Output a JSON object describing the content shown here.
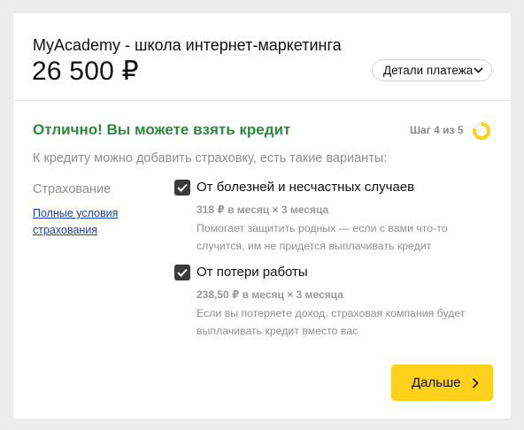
{
  "order": {
    "merchant": "MyAcademy - школа интернет-маркетинга",
    "amount": "26 500 ₽",
    "details_label": "Детали платежа"
  },
  "status": {
    "title": "Отлично! Вы можете взять кредит",
    "step": "Шаг 4 из 5",
    "step_progress": 0.8,
    "subtitle": "К кредиту можно добавить страховку, есть такие варианты:"
  },
  "insurance": {
    "label": "Страхование",
    "terms_link_line1": "Полные условия",
    "terms_link_line2": "страхования",
    "options": [
      {
        "title": "От болезней и несчастных случаев",
        "price": "318 ₽ в месяц × 3 месяца",
        "desc_line1": "Помогает защитить родных — если с вами что-то",
        "desc_line2": "случится, им не придется выплачивать кредит",
        "checked": true
      },
      {
        "title": "От потери работы",
        "price": "238,50 ₽ в месяц × 3 месяца",
        "desc_line1": "Если вы потеряете доход, страховая компания будет",
        "desc_line2": "выплачивать кредит вместо вас",
        "checked": true
      }
    ]
  },
  "actions": {
    "next_label": "Дальше"
  },
  "colors": {
    "success_green": "#2b8a3e",
    "accent_yellow": "#ffd11a",
    "link_blue": "#1a3ea6",
    "checkbox_dark": "#3b3b3b"
  },
  "icons": {
    "details_chevron": "chevron-down-icon",
    "step_ring": "progress-ring-icon",
    "checkbox_check": "check-icon",
    "next_chevron": "chevron-right-icon"
  }
}
